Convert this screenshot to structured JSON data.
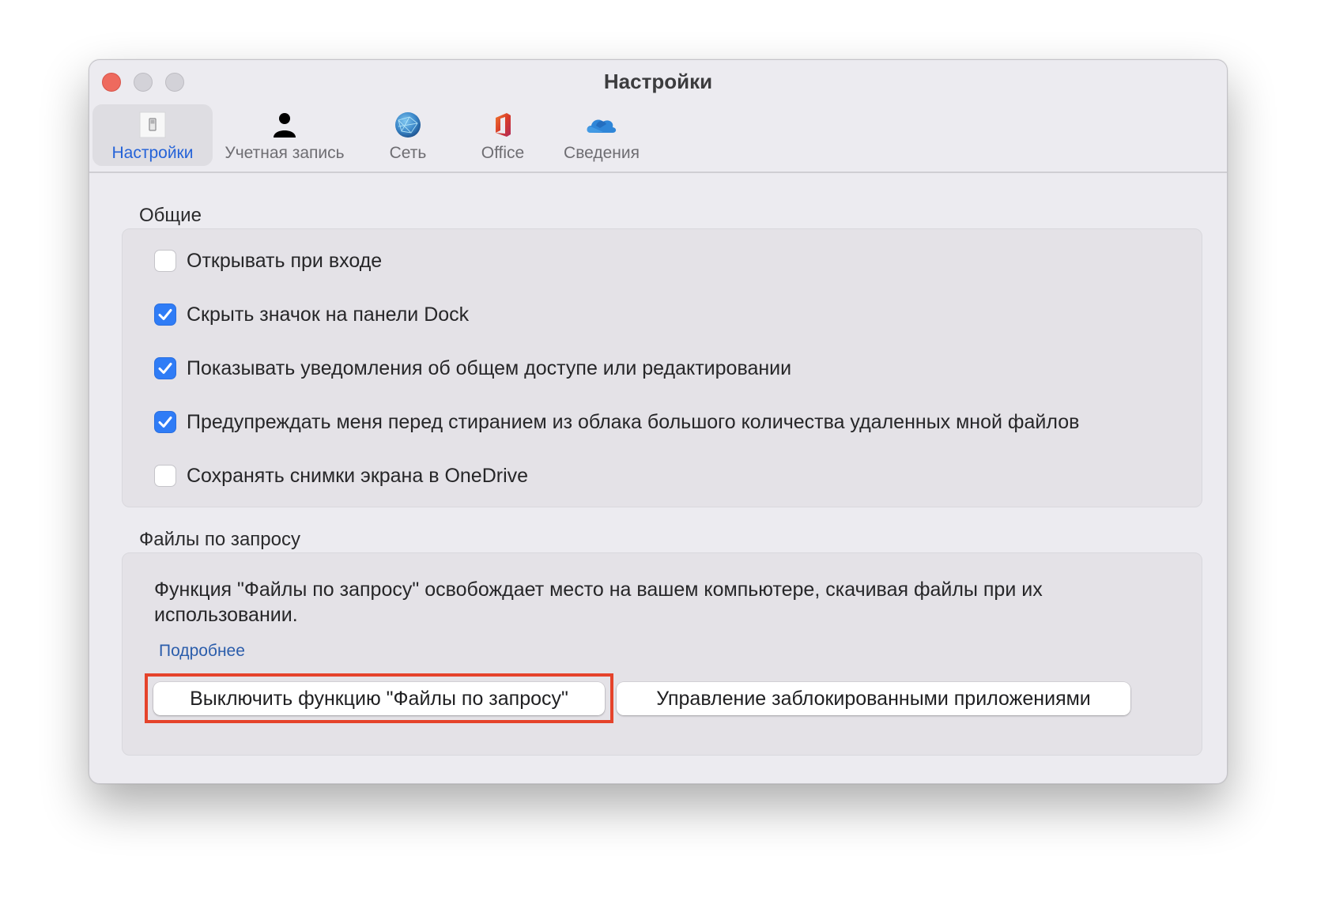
{
  "window": {
    "title": "Настройки",
    "controls": [
      "close",
      "minimize",
      "zoom"
    ]
  },
  "toolbar": {
    "tabs": [
      {
        "label": "Настройки",
        "icon": "switch-icon",
        "active": true
      },
      {
        "label": "Учетная запись",
        "icon": "person-icon",
        "active": false
      },
      {
        "label": "Сеть",
        "icon": "globe-icon",
        "active": false
      },
      {
        "label": "Office",
        "icon": "office-icon",
        "active": false
      },
      {
        "label": "Сведения",
        "icon": "cloud-icon",
        "active": false
      }
    ]
  },
  "general": {
    "label": "Общие",
    "options": [
      {
        "label": "Открывать при входе",
        "checked": false
      },
      {
        "label": "Скрыть значок на панели Dock",
        "checked": true
      },
      {
        "label": "Показывать уведомления об общем доступе или редактировании",
        "checked": true
      },
      {
        "label": "Предупреждать меня перед стиранием из облака большого количества удаленных мной файлов",
        "checked": true
      },
      {
        "label": "Сохранять снимки экрана в OneDrive",
        "checked": false
      }
    ]
  },
  "files_on_demand": {
    "label": "Файлы по запросу",
    "description": "Функция \"Файлы по запросу\" освобождает место на вашем компьютере, скачивая файлы при их использовании.",
    "learn_more": "Подробнее",
    "buttons": {
      "turn_off": "Выключить функцию \"Файлы по запросу\"",
      "manage_blocked": "Управление заблокированными приложениями"
    },
    "highlighted_button": "turn_off"
  },
  "colors": {
    "accent": "#2563d8",
    "checkbox_on": "#2f7cf6",
    "link": "#2b5dab",
    "highlight": "#e5432b",
    "close_button": "#ee6a5e"
  }
}
